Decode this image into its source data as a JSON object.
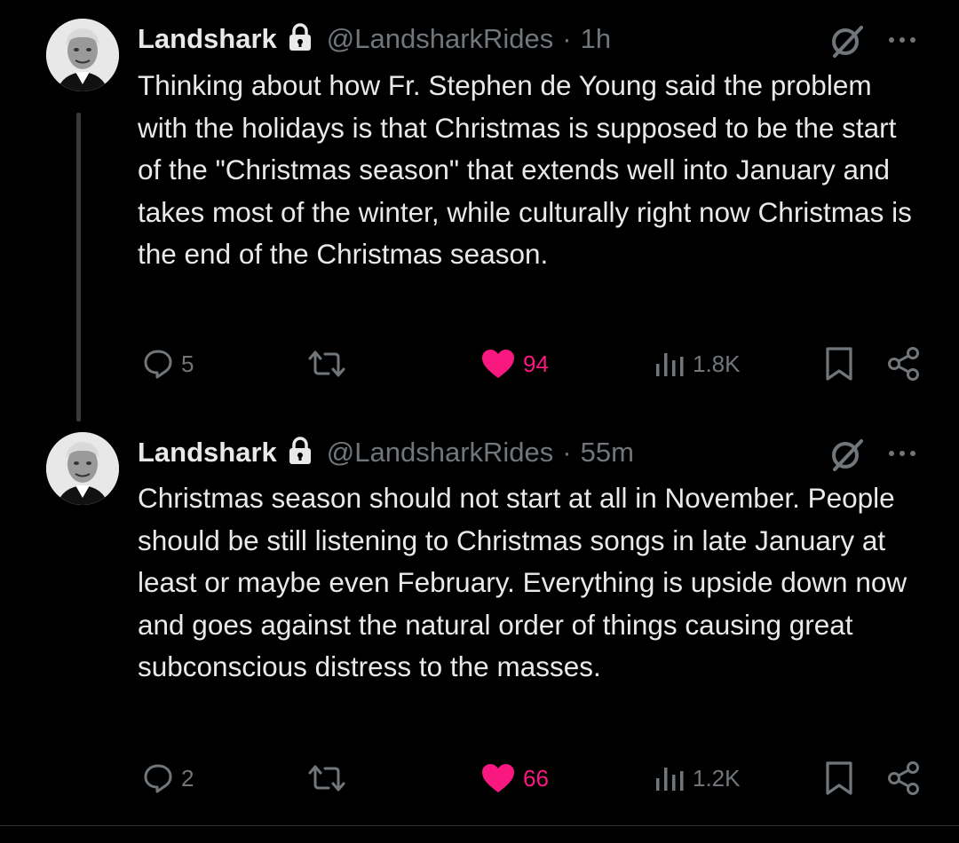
{
  "tweets": [
    {
      "author_name": "Landshark",
      "handle": "@LandsharkRides",
      "separator": "·",
      "time": "1h",
      "text": "Thinking about how Fr. Stephen de Young said the problem with the holidays is that Christmas is supposed to be the start of the \"Christmas season\" that extends well into January and takes most of the winter, while culturally right now Christmas is the end of the Christmas season.",
      "replies": "5",
      "likes": "94",
      "views": "1.8K",
      "liked": true
    },
    {
      "author_name": "Landshark",
      "handle": "@LandsharkRides",
      "separator": "·",
      "time": "55m",
      "text": "Christmas season should not start at all in November. People should be still listening to Christmas songs in late January at least or maybe even February. Everything is upside down now and goes against the natural order of things causing great subconscious distress to the masses.",
      "replies": "2",
      "likes": "66",
      "views": "1.2K",
      "liked": true
    }
  ],
  "colors": {
    "background": "#000000",
    "text": "#e7e9ea",
    "muted": "#71767b",
    "like": "#f91880",
    "thread_line": "#3a3a3a"
  },
  "icons": [
    "lock-icon",
    "grok-icon",
    "more-icon",
    "reply-icon",
    "retweet-icon",
    "heart-icon",
    "views-icon",
    "bookmark-icon",
    "share-icon"
  ]
}
